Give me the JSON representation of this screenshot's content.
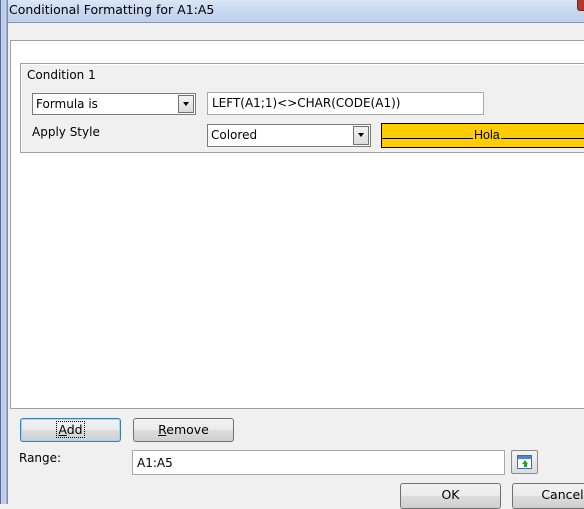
{
  "window": {
    "title": "Conditional Formatting for A1:A5"
  },
  "condition": {
    "heading": "Condition 1",
    "type_select": {
      "value": "Formula is"
    },
    "formula": {
      "value": "LEFT(A1;1)<>CHAR(CODE(A1))"
    },
    "apply_style_label": "Apply Style",
    "style_select": {
      "value": "Colored"
    },
    "preview": {
      "text": "Hola",
      "background": "#ffcc00"
    }
  },
  "actions": {
    "add_label": "Add",
    "add_mnemonic": "A",
    "add_rest": "dd",
    "remove_label": "Remove",
    "remove_mnemonic": "R",
    "remove_rest": "emove"
  },
  "range": {
    "label": "Range:",
    "value": "A1:A5"
  },
  "footer": {
    "ok_label": "OK",
    "cancel_label": "Cancel"
  }
}
